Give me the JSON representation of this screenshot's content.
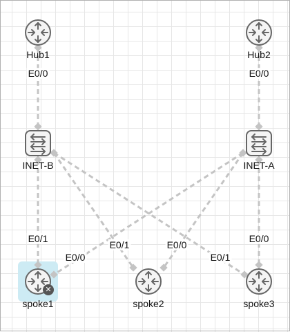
{
  "nodes": {
    "hub1": {
      "label": "Hub1",
      "kind": "router",
      "icon": "router-icon"
    },
    "hub2": {
      "label": "Hub2",
      "kind": "router",
      "icon": "router-icon"
    },
    "inetb": {
      "label": "INET-B",
      "kind": "switch",
      "icon": "switch-icon"
    },
    "ineta": {
      "label": "INET-A",
      "kind": "switch",
      "icon": "switch-icon"
    },
    "spoke1": {
      "label": "spoke1",
      "kind": "router",
      "icon": "router-icon",
      "selected": true
    },
    "spoke2": {
      "label": "spoke2",
      "kind": "router",
      "icon": "router-icon"
    },
    "spoke3": {
      "label": "spoke3",
      "kind": "router",
      "icon": "router-icon"
    }
  },
  "links": [
    {
      "from": "hub1",
      "to": "inetb",
      "port": "E0/0"
    },
    {
      "from": "hub2",
      "to": "ineta",
      "port": "E0/0"
    },
    {
      "from": "inetb",
      "to": "spoke1",
      "port": "E0/1"
    },
    {
      "from": "inetb",
      "to": "spoke2",
      "port": "E0/1"
    },
    {
      "from": "inetb",
      "to": "spoke3",
      "port": "E0/1"
    },
    {
      "from": "ineta",
      "to": "spoke1",
      "port": "E0/0"
    },
    {
      "from": "ineta",
      "to": "spoke2",
      "port": "E0/0"
    },
    {
      "from": "ineta",
      "to": "spoke3",
      "port": "E0/0"
    }
  ],
  "delete_icon": "close-icon",
  "colors": {
    "link": "#c4c4c4",
    "icon_fill": "#f4f4f4",
    "icon_stroke": "#666666",
    "selection": "#cdebf4",
    "badge": "#555555"
  }
}
